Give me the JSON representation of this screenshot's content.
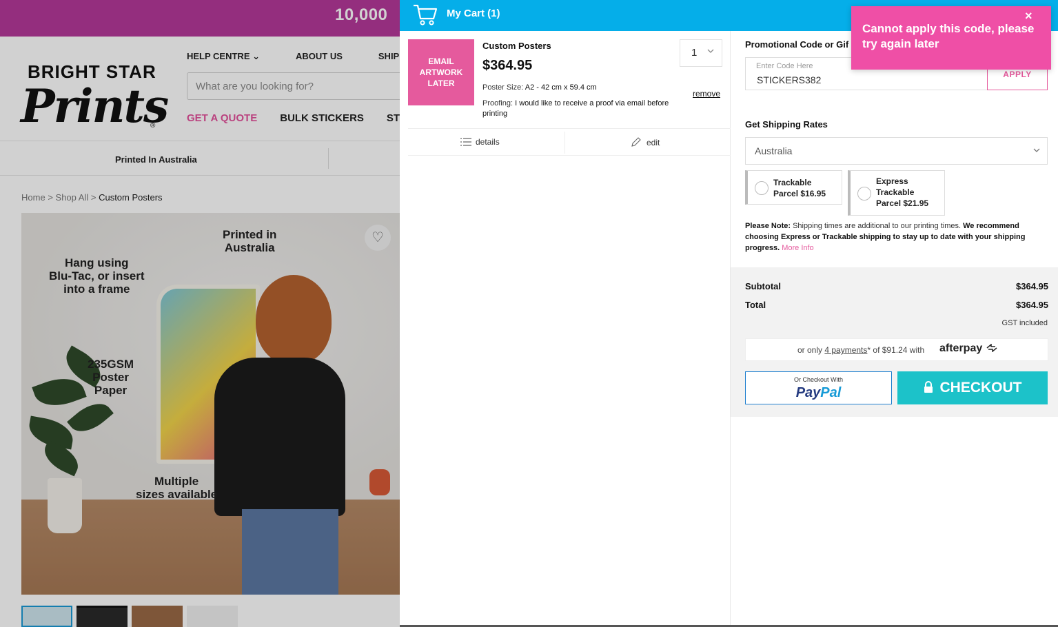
{
  "site": {
    "promo_banner": "10,000",
    "logo": {
      "line1": "BRIGHT STAR",
      "line2": "Prints",
      "reg": "®"
    },
    "top_nav": [
      "HELP CENTRE ⌄",
      "ABOUT US",
      "SHIPPIN"
    ],
    "search_placeholder": "What are you looking for?",
    "category_nav": [
      "GET A QUOTE",
      "BULK STICKERS",
      "STIC"
    ],
    "strip_text": "Printed In Australia",
    "breadcrumb": {
      "home": "Home",
      "sep1": ">",
      "shop": "Shop All",
      "sep2": ">",
      "current": "Custom Posters"
    },
    "hero_annotations": {
      "printed": "Printed in\nAustralia",
      "hang": "Hang using\nBlu-Tac, or insert\ninto a frame",
      "paper": "235GSM\nPoster\nPaper",
      "sizes": "Multiple\nsizes available"
    },
    "colors": {
      "brand_pink": "#e3519b",
      "promo_bar": "#b5399a"
    }
  },
  "cart": {
    "title": "My Cart (1)",
    "header_color": "#05aee9",
    "item": {
      "thumb_text": "EMAIL\nARTWORK\nLATER",
      "name": "Custom Posters",
      "price": "$364.95",
      "size_label": "Poster Size:",
      "size_value": "A2 - 42 cm x 59.4 cm",
      "proof_label": "Proofing:",
      "proof_value": "I would like to receive a proof via email before printing",
      "quantity": "1",
      "remove_label": "remove",
      "details_label": "details",
      "edit_label": "edit"
    },
    "promo": {
      "label": "Promotional Code or Gif",
      "placeholder": "Enter Code Here",
      "value": "STICKERS382",
      "apply_label": "APPLY"
    },
    "shipping": {
      "label": "Get Shipping Rates",
      "country": "Australia",
      "options": [
        {
          "label": "Trackable\nParcel $16.95"
        },
        {
          "label": "Express\nTrackable\nParcel $21.95"
        }
      ],
      "note_bold": "Please Note:",
      "note_text": " Shipping times are additional to our printing times. ",
      "note_bold2": "We recommend choosing Express or Trackable shipping to stay up to date with your shipping progress.",
      "more_info": "More Info"
    },
    "totals": {
      "subtotal_label": "Subtotal",
      "subtotal_value": "$364.95",
      "total_label": "Total",
      "total_value": "$364.95",
      "gst_note": "GST included"
    },
    "afterpay": {
      "prefix": "or only ",
      "payments": "4 payments",
      "star": "*",
      "middle": " of $91.24 with",
      "brand": "afterpay"
    },
    "paypal": {
      "small": "Or Checkout With",
      "brand_part1": "Pay",
      "brand_part2": "Pal"
    },
    "checkout_label": "CHECKOUT",
    "checkout_color": "#1cc2c9"
  },
  "toast": {
    "message": "Cannot apply this code, please try again later",
    "close": "×",
    "color": "#ef4fa6"
  }
}
